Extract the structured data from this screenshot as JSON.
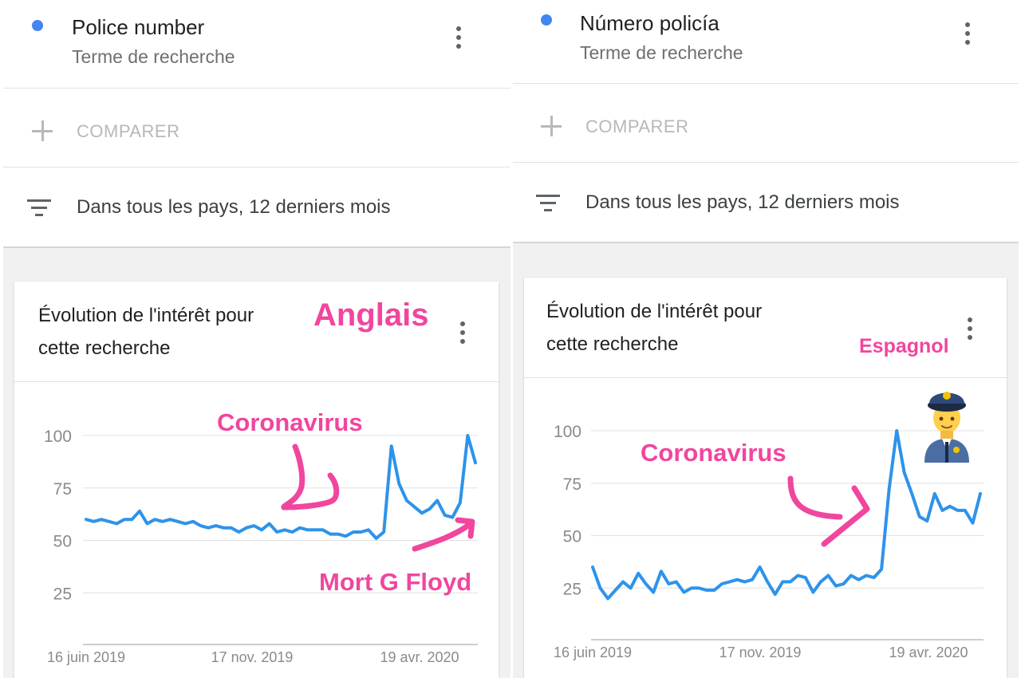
{
  "left_panel": {
    "term": {
      "name": "Police number",
      "type": "Terme de recherche",
      "dot_color": "#4285f4"
    },
    "compare_label": "COMPARER",
    "filter_label": "Dans tous les pays, 12 derniers mois",
    "chart_card": {
      "title_line1": "Évolution de l'intérêt pour",
      "title_line2": "cette recherche",
      "annotations": {
        "language": "Anglais",
        "coronavirus": "Coronavirus",
        "floyd": "Mort G Floyd"
      }
    }
  },
  "right_panel": {
    "term": {
      "name": "Número policía",
      "type": "Terme de recherche",
      "dot_color": "#4285f4"
    },
    "compare_label": "COMPARER",
    "filter_label": "Dans tous les pays, 12 derniers mois",
    "chart_card": {
      "title_line1": "Évolution de l'intérêt pour",
      "title_line2": "cette recherche",
      "annotations": {
        "language": "Espagnol",
        "coronavirus": "Coronavirus"
      },
      "icon": "police-officer-icon"
    }
  },
  "colors": {
    "line": "#2e93ea",
    "annotation": "#f0469e",
    "grid": "#e0e0e0",
    "axis_text": "#8a8a8a"
  },
  "chart_data": [
    {
      "type": "line",
      "yticks": [
        25,
        50,
        75,
        100
      ],
      "ylim": [
        0,
        100
      ],
      "xticklabels": [
        "16 juin 2019",
        "17 nov. 2019",
        "19 avr. 2020"
      ],
      "series": [
        {
          "values": [
            60,
            59,
            60,
            59,
            58,
            60,
            60,
            64,
            58,
            60,
            59,
            60,
            59,
            58,
            59,
            57,
            56,
            57,
            56,
            56,
            54,
            56,
            57,
            55,
            58,
            54,
            55,
            54,
            56,
            55,
            55,
            55,
            53,
            53,
            52,
            54,
            54,
            55,
            51,
            54,
            95,
            77,
            69,
            66,
            63,
            65,
            69,
            62,
            61,
            68,
            100,
            87
          ]
        }
      ]
    },
    {
      "type": "line",
      "yticks": [
        25,
        50,
        75,
        100
      ],
      "ylim": [
        0,
        100
      ],
      "xticklabels": [
        "16 juin 2019",
        "17 nov. 2019",
        "19 avr. 2020"
      ],
      "series": [
        {
          "values": [
            35,
            25,
            20,
            24,
            28,
            25,
            32,
            27,
            23,
            33,
            27,
            28,
            23,
            25,
            25,
            24,
            24,
            27,
            28,
            29,
            28,
            29,
            35,
            28,
            22,
            28,
            28,
            31,
            30,
            23,
            28,
            31,
            26,
            27,
            31,
            29,
            31,
            30,
            34,
            72,
            100,
            80,
            70,
            59,
            57,
            70,
            62,
            64,
            62,
            62,
            56,
            70
          ]
        }
      ]
    }
  ]
}
